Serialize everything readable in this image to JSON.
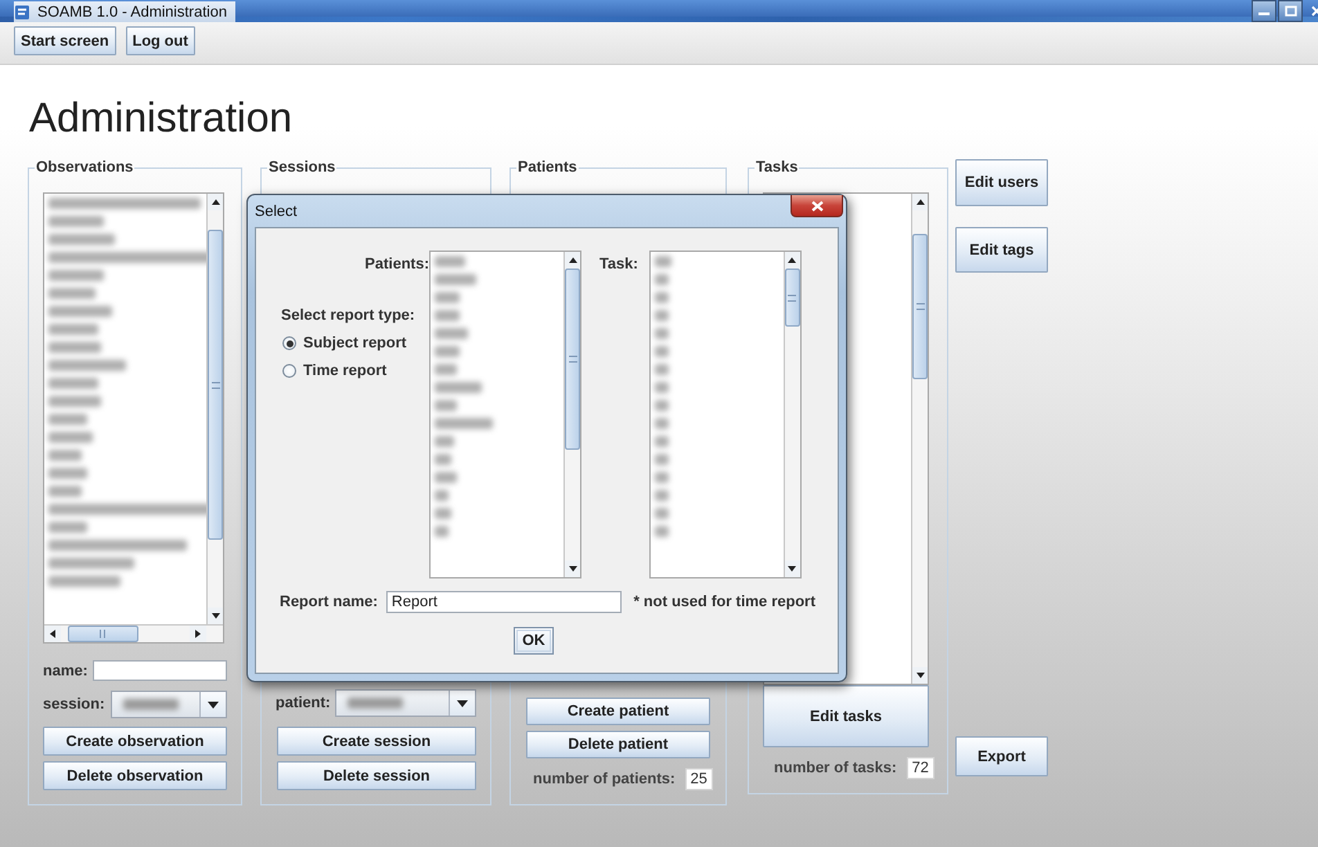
{
  "window": {
    "title": "SOAMB 1.0 - Administration"
  },
  "toolbar": [
    "Start screen",
    "Log out"
  ],
  "heading": "Administration",
  "panels": [
    {
      "kind": "observations",
      "title": "Observations",
      "fields": [
        {
          "kind": "text",
          "label": "name:"
        },
        {
          "kind": "combo",
          "label": "session:"
        }
      ],
      "buttons": [
        "Create observation",
        "Delete observation"
      ]
    },
    {
      "kind": "sessions",
      "title": "Sessions",
      "fields": [
        {
          "kind": "combo",
          "label": "patient:"
        }
      ],
      "buttons": [
        "Create session",
        "Delete session"
      ]
    },
    {
      "kind": "patients",
      "title": "Patients",
      "buttons": [
        "Create patient",
        "Delete patient"
      ],
      "count_label": "number of patients:",
      "count": "25"
    },
    {
      "kind": "tasks",
      "title": "Tasks",
      "buttons": [
        "Edit tasks"
      ],
      "count_label": "number of tasks:",
      "count": "72"
    }
  ],
  "side_buttons": [
    "Edit users",
    "Edit tags",
    "Export"
  ],
  "dialog": {
    "title": "Select",
    "patients_label": "Patients:",
    "task_label": "Task:",
    "report_type_label": "Select report type:",
    "report_types": [
      {
        "label": "Subject report",
        "selected": true
      },
      {
        "label": "Time report",
        "selected": false
      }
    ],
    "report_name_label": "Report name:",
    "report_name": "Report",
    "note": "* not used for time report",
    "ok": "OK"
  }
}
